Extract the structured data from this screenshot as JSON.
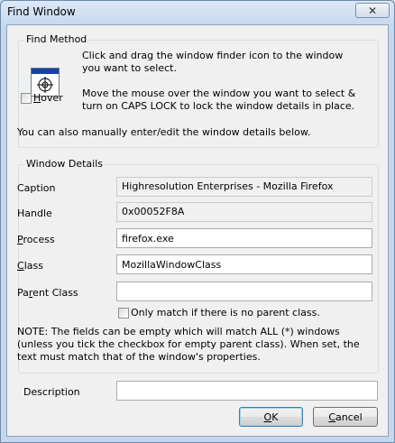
{
  "window": {
    "title": "Find Window",
    "close_glyph": "✕"
  },
  "find_method": {
    "legend": "Find Method",
    "instruction_drag": "Click and drag the window finder icon to the window you want to select.",
    "hover_label_pre": "",
    "hover_label_u": "H",
    "hover_label_post": "over",
    "hover_checked": false,
    "instruction_hover": "Move the mouse over the window you want to select & turn on CAPS LOCK to lock the window details in place.",
    "manual_note": "You can also manually enter/edit the window details below.",
    "finder_icon": "crosshair-target-icon"
  },
  "details": {
    "legend": "Window Details",
    "caption_label": "Caption",
    "caption_value": "Highresolution Enterprises - Mozilla Firefox",
    "handle_label": "Handle",
    "handle_value": "0x00052F8A",
    "process_label_u": "P",
    "process_label_post": "rocess",
    "process_value": "firefox.exe",
    "class_label_u": "C",
    "class_label_post": "lass",
    "class_value": "MozillaWindowClass",
    "parent_class_label_pre": "Pa",
    "parent_class_label_u": "r",
    "parent_class_label_post": "ent Class",
    "parent_class_value": "",
    "only_match_label": "Only match if there is no parent class.",
    "only_match_checked": false,
    "note": "NOTE: The fields can be empty which will match ALL (*) windows (unless you tick the checkbox for empty parent class). When set, the text must match that of the window's properties."
  },
  "description": {
    "label": "Description",
    "value": ""
  },
  "buttons": {
    "ok_u": "O",
    "ok_post": "K",
    "cancel_u": "C",
    "cancel_post": "ancel"
  }
}
